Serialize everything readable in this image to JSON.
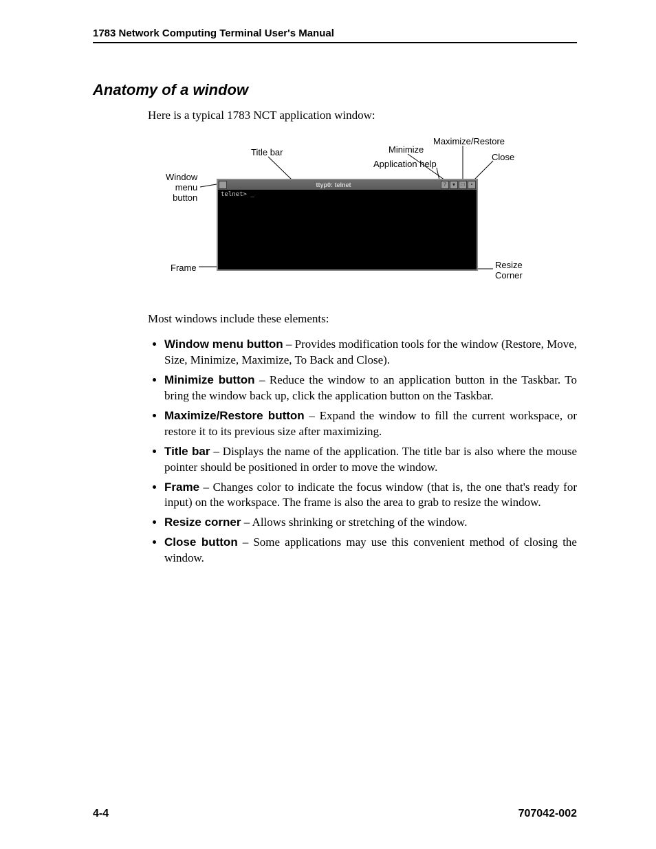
{
  "header": "1783 Network Computing Terminal User's Manual",
  "section_title": "Anatomy of a window",
  "intro": "Here is a typical 1783 NCT application window:",
  "diagram": {
    "labels": {
      "title_bar": "Title bar",
      "minimize": "Minimize",
      "maximize_restore": "Maximize/Restore",
      "app_help": "Application help",
      "close": "Close",
      "window_menu_button": "Window\nmenu\nbutton",
      "frame": "Frame",
      "resize_corner": "Resize\nCorner"
    },
    "window": {
      "title": "ttyp0: telnet",
      "prompt": "telnet> _"
    }
  },
  "elements_intro": "Most windows include these elements:",
  "elements": [
    {
      "term": "Window menu button",
      "desc": " – Provides modification tools for the window (Restore, Move, Size, Minimize, Maximize, To Back and Close)."
    },
    {
      "term": "Minimize button",
      "desc": " – Reduce the window to an application button in the Taskbar. To bring the window back up, click the application button on the Taskbar."
    },
    {
      "term": "Maximize/Restore button",
      "desc": " – Expand the window to fill the current workspace, or restore it to its previous size after maximizing."
    },
    {
      "term": "Title bar",
      "desc": " – Displays the name of the application. The title bar is also where the mouse pointer should be positioned in order to move the window."
    },
    {
      "term": "Frame",
      "desc": " – Changes color to indicate the focus window (that is, the one that's ready for input) on the workspace. The frame is also the area to grab to resize the window."
    },
    {
      "term": "Resize corner",
      "desc": " – Allows shrinking or stretching of the window."
    },
    {
      "term": "Close button",
      "desc": " – Some applications may use this convenient method of closing the window."
    }
  ],
  "footer": {
    "page": "4-4",
    "docnum": "707042-002"
  }
}
